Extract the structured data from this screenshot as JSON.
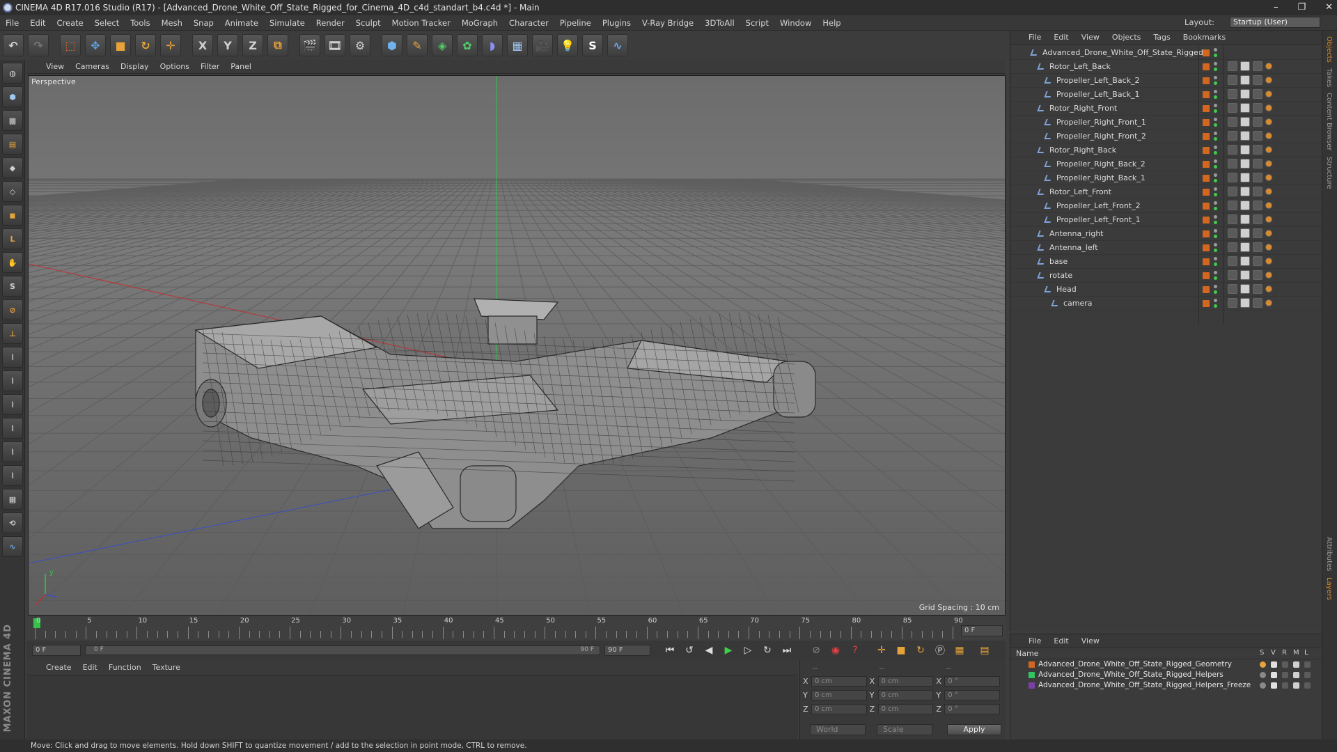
{
  "window": {
    "title": "CINEMA 4D R17.016 Studio (R17) - [Advanced_Drone_White_Off_State_Rigged_for_Cinema_4D_c4d_standart_b4.c4d *] - Main",
    "controls": [
      "–",
      "❐",
      "✕"
    ]
  },
  "menubar": {
    "items": [
      "File",
      "Edit",
      "Create",
      "Select",
      "Tools",
      "Mesh",
      "Snap",
      "Animate",
      "Simulate",
      "Render",
      "Sculpt",
      "Motion Tracker",
      "MoGraph",
      "Character",
      "Pipeline",
      "Plugins",
      "V-Ray Bridge",
      "3DToAll",
      "Script",
      "Window",
      "Help"
    ],
    "layout_label": "Layout:",
    "layout_value": "Startup (User)"
  },
  "toolbar": {
    "axis_x": "X",
    "axis_y": "Y",
    "axis_z": "Z"
  },
  "viewport": {
    "menu": [
      "View",
      "Cameras",
      "Display",
      "Options",
      "Filter",
      "Panel"
    ],
    "label": "Perspective",
    "grid_info": "Grid Spacing : 10 cm"
  },
  "timeline": {
    "ticks": [
      "0",
      "5",
      "10",
      "15",
      "20",
      "25",
      "30",
      "35",
      "40",
      "45",
      "50",
      "55",
      "60",
      "65",
      "70",
      "75",
      "80",
      "85",
      "90"
    ],
    "current_frame_right": "0 F",
    "start_frame": "0 F",
    "range_start": "0 F",
    "range_end": "90 F",
    "end_frame": "90 F"
  },
  "material_panel": {
    "menu": [
      "Create",
      "Edit",
      "Function",
      "Texture"
    ]
  },
  "coordinates": {
    "headers": [
      "--",
      "--",
      "--"
    ],
    "rows": [
      {
        "axis": "X",
        "pos": "0 cm",
        "axis2": "X",
        "size": "0 cm",
        "axis3": "X",
        "rot": "0 °"
      },
      {
        "axis": "Y",
        "pos": "0 cm",
        "axis2": "Y",
        "size": "0 cm",
        "axis3": "Y",
        "rot": "0 °"
      },
      {
        "axis": "Z",
        "pos": "0 cm",
        "axis2": "Z",
        "size": "0 cm",
        "axis3": "Z",
        "rot": "0 °"
      }
    ],
    "world": "World",
    "scale": "Scale",
    "apply": "Apply"
  },
  "object_manager": {
    "menu": [
      "File",
      "Edit",
      "View",
      "Objects",
      "Tags",
      "Bookmarks"
    ],
    "objects": [
      {
        "name": "Advanced_Drone_White_Off_State_Rigged",
        "depth": 0
      },
      {
        "name": "Rotor_Left_Back",
        "depth": 1
      },
      {
        "name": "Propeller_Left_Back_2",
        "depth": 2
      },
      {
        "name": "Propeller_Left_Back_1",
        "depth": 2
      },
      {
        "name": "Rotor_Right_Front",
        "depth": 1
      },
      {
        "name": "Propeller_Right_Front_1",
        "depth": 2
      },
      {
        "name": "Propeller_Right_Front_2",
        "depth": 2
      },
      {
        "name": "Rotor_Right_Back",
        "depth": 1
      },
      {
        "name": "Propeller_Right_Back_2",
        "depth": 2
      },
      {
        "name": "Propeller_Right_Back_1",
        "depth": 2
      },
      {
        "name": "Rotor_Left_Front",
        "depth": 1
      },
      {
        "name": "Propeller_Left_Front_2",
        "depth": 2
      },
      {
        "name": "Propeller_Left_Front_1",
        "depth": 2
      },
      {
        "name": "Antenna_right",
        "depth": 1
      },
      {
        "name": "Antenna_left",
        "depth": 1
      },
      {
        "name": "base",
        "depth": 1
      },
      {
        "name": "rotate",
        "depth": 1
      },
      {
        "name": "Head",
        "depth": 2
      },
      {
        "name": "camera",
        "depth": 3
      }
    ]
  },
  "right_tabs": [
    "Objects",
    "Takes",
    "Content Browser",
    "Structure",
    "Attributes",
    "Layers"
  ],
  "layer_manager": {
    "menu": [
      "File",
      "Edit",
      "View"
    ],
    "columns": {
      "name": "Name",
      "s": "S",
      "v": "V",
      "r": "R",
      "m": "M",
      "l": "L"
    },
    "layers": [
      {
        "name": "Advanced_Drone_White_Off_State_Rigged_Geometry",
        "color": "#d4671f"
      },
      {
        "name": "Advanced_Drone_White_Off_State_Rigged_Helpers",
        "color": "#2fc462"
      },
      {
        "name": "Advanced_Drone_White_Off_State_Rigged_Helpers_Freeze",
        "color": "#7b3fa8"
      }
    ]
  },
  "status": "Move: Click and drag to move elements. Hold down SHIFT to quantize movement / add to the selection in point mode, CTRL to remove.",
  "brand": "MAXON CINEMA 4D"
}
